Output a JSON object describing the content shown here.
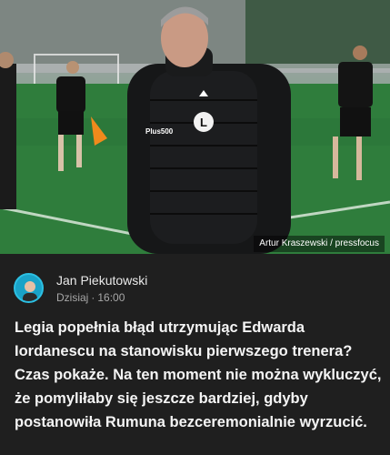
{
  "photo": {
    "credit": "Artur Kraszewski / pressfocus",
    "badge_text": "L",
    "sponsor_text": "Plus500"
  },
  "post": {
    "author": "Jan Piekutowski",
    "date_label": "Dzisiaj",
    "separator": "·",
    "time": "16:00",
    "headline": "Legia popełnia błąd utrzymując Edwarda Iordanescu na stanowisku pierwszego trenera? Czas pokaże. Na ten moment nie można wykluczyć, że pomyliłaby się jeszcze bardziej, gdyby postanowiła Rumuna bezceremonialnie wyrzucić."
  },
  "colors": {
    "background": "#1f1f1f",
    "text": "#f4f4f4",
    "muted": "#a7a7a7",
    "avatar_ring": "#2cc0e3"
  }
}
